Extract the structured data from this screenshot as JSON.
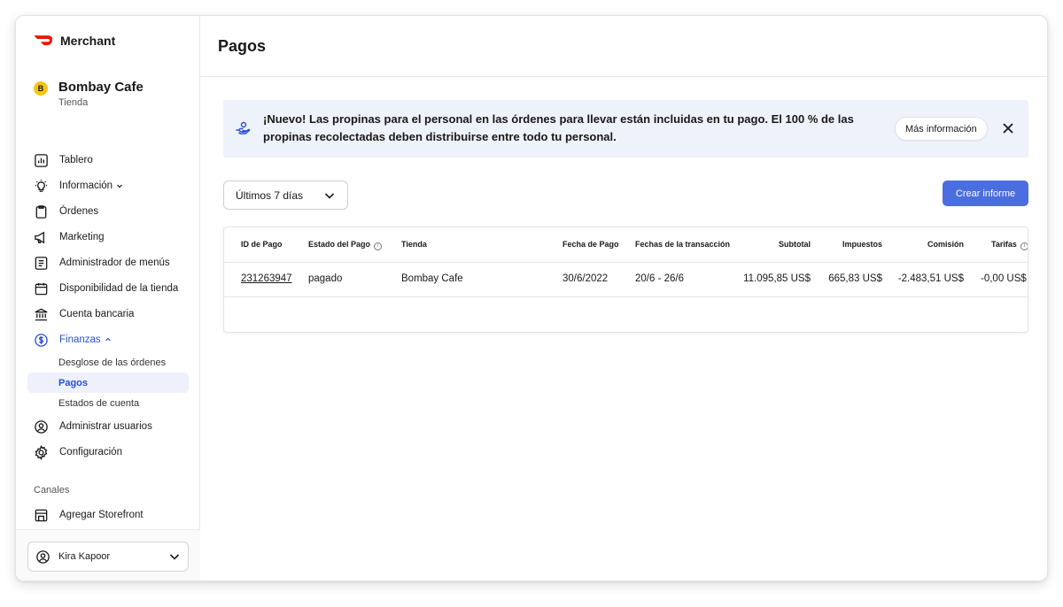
{
  "app": {
    "brand": "Merchant"
  },
  "store": {
    "initial": "B",
    "name": "Bombay Cafe",
    "subtitle": "Tienda"
  },
  "nav": {
    "tablero": "Tablero",
    "informacion": "Información",
    "ordenes": "Órdenes",
    "marketing": "Marketing",
    "menus": "Administrador de menús",
    "disponibilidad": "Disponibilidad de la tienda",
    "cuenta": "Cuenta bancaria",
    "finanzas": "Finanzas",
    "finanzas_sub": [
      "Desglose de las órdenes",
      "Pagos",
      "Estados de cuenta"
    ],
    "usuarios": "Administrar usuarios",
    "config": "Configuración",
    "canales_label": "Canales",
    "storefront": "Agregar Storefront"
  },
  "user": {
    "name": "Kira Kapoor"
  },
  "page": {
    "title": "Pagos"
  },
  "banner": {
    "text": "¡Nuevo! Las propinas para el personal en las órdenes para llevar están incluidas en tu pago. El 100 % de las propinas recolectadas deben distribuirse entre todo tu personal.",
    "button": "Más información"
  },
  "filters": {
    "range": "Últimos 7 días"
  },
  "actions": {
    "create_report": "Crear informe"
  },
  "table": {
    "headers": [
      "ID de Pago",
      "Estado del Pago",
      "Tienda",
      "Fecha de Pago",
      "Fechas de la transacción",
      "Subtotal",
      "Impuestos",
      "Comisión",
      "Tarifas"
    ],
    "rows": [
      [
        "231263947",
        "pagado",
        "Bombay Cafe",
        "30/6/2022",
        "20/6 - 26/6",
        "11.095,85 US$",
        "665,83 US$",
        "-2.483,51 US$",
        "-0,00 US$"
      ]
    ]
  },
  "colors": {
    "accent": "#4a6ee0",
    "active": "#2a4fd8",
    "brand": "#eb1700",
    "banner_bg": "#eef2fb"
  }
}
